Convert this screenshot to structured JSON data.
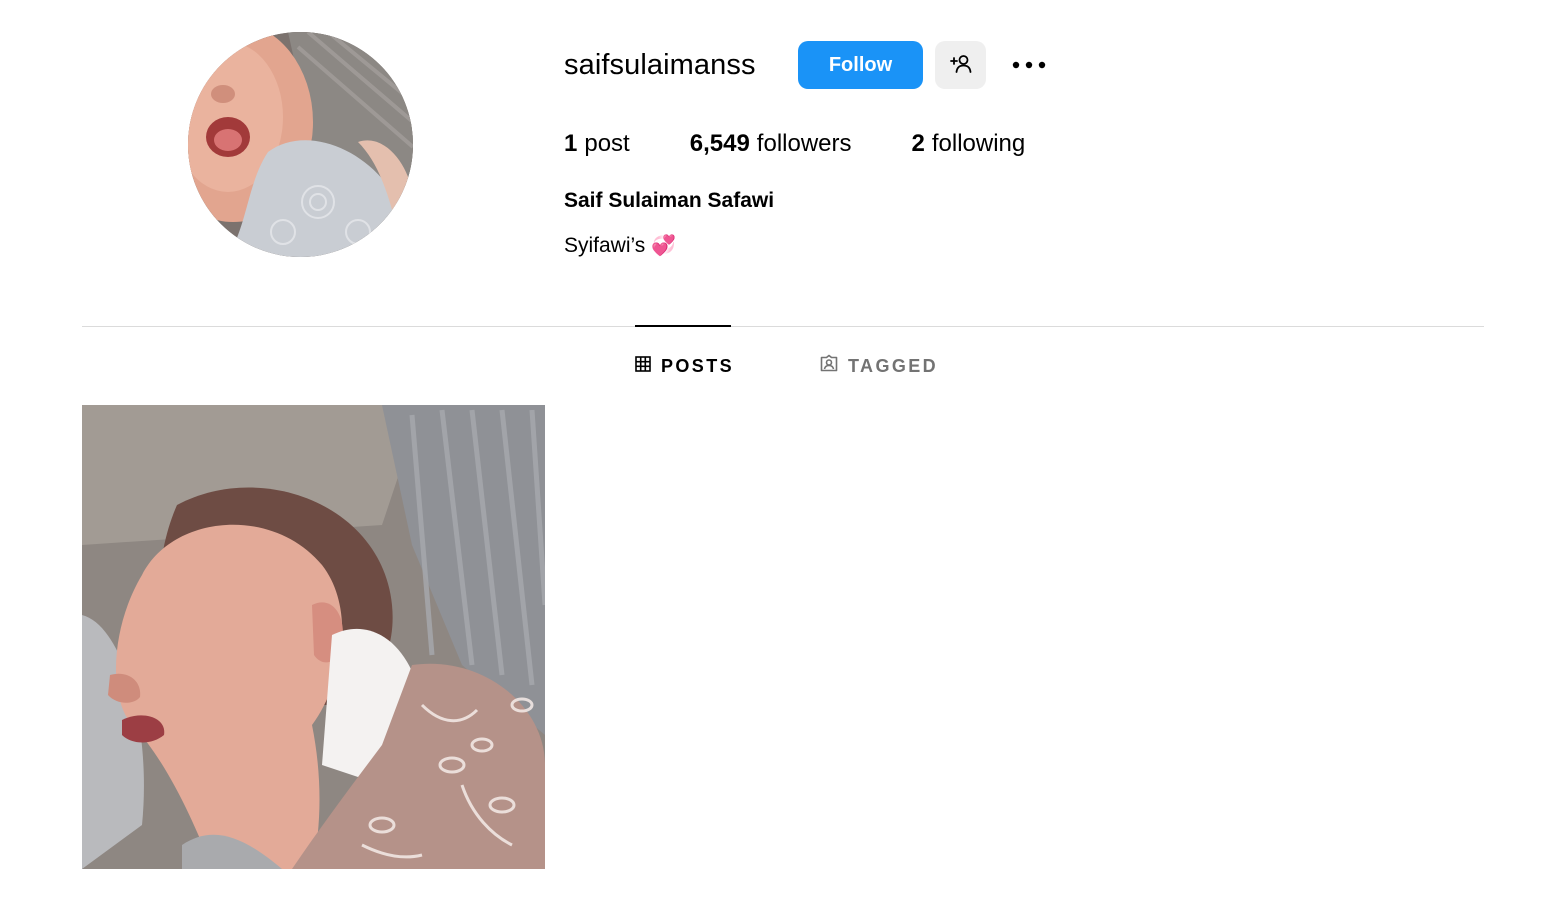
{
  "profile": {
    "username": "saifsulaimanss",
    "full_name": "Saif Sulaiman Safawi",
    "bio_text": "Syifawi’s",
    "bio_emoji": "💞",
    "avatar": "profile-photo-baby"
  },
  "actions": {
    "follow_label": "Follow",
    "add_user_icon": "add-user-icon",
    "more_icon": "more-options-icon"
  },
  "stats": {
    "posts_count": "1",
    "posts_label": "post",
    "followers_count": "6,549",
    "followers_label": "followers",
    "following_count": "2",
    "following_label": "following"
  },
  "tabs": [
    {
      "label": "POSTS",
      "icon": "grid-icon",
      "active": true
    },
    {
      "label": "TAGGED",
      "icon": "tagged-icon",
      "active": false
    }
  ],
  "posts": [
    {
      "image": "sleeping-newborn-photo"
    }
  ],
  "colors": {
    "follow_button": "#1a93f7",
    "secondary_button": "#efefef",
    "divider": "#dbdbdb",
    "inactive_tab": "#737373"
  }
}
